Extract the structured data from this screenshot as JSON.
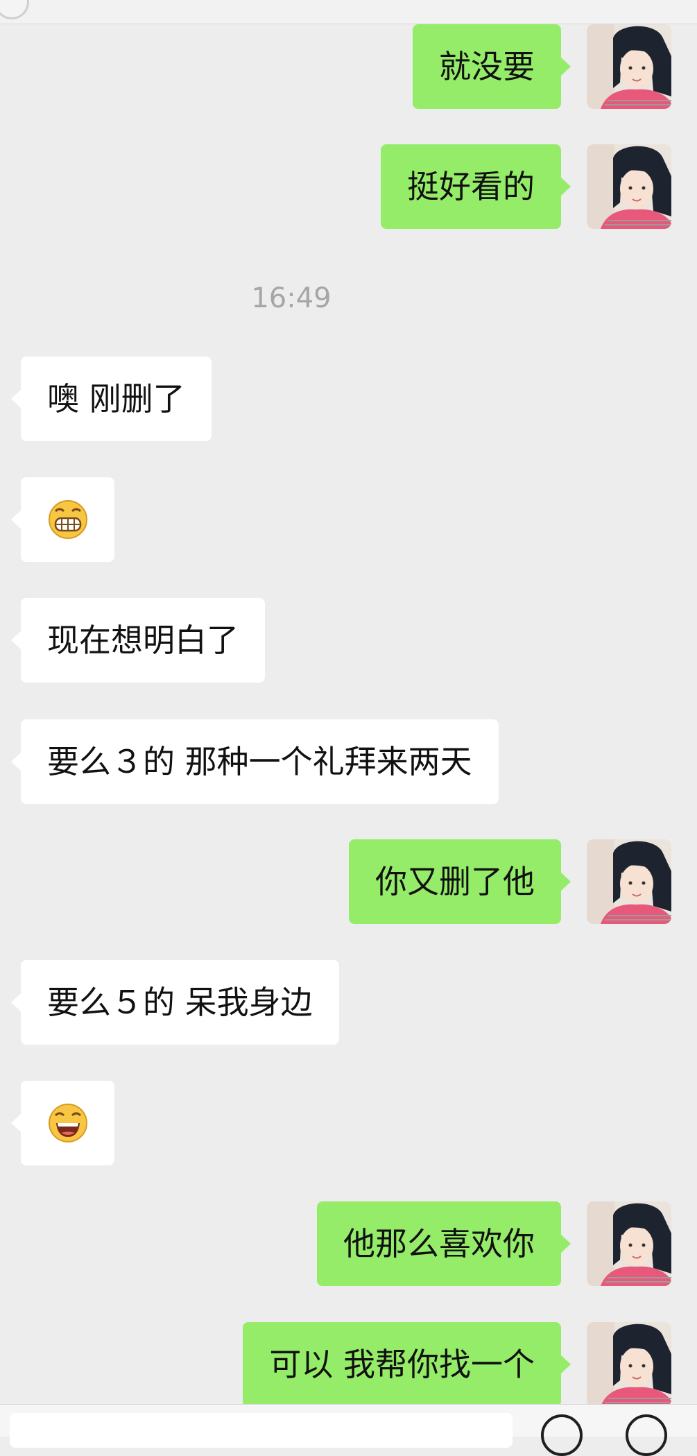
{
  "chat": {
    "timestamp": "16:49",
    "messages": [
      {
        "side": "out",
        "text": "就没要"
      },
      {
        "side": "out",
        "text": "挺好看的"
      },
      {
        "side": "in",
        "text": "噢 刚删了"
      },
      {
        "side": "in",
        "emoji": "grin-face"
      },
      {
        "side": "in",
        "text": "现在想明白了"
      },
      {
        "side": "in",
        "text": "要么３的 那种一个礼拜来两天"
      },
      {
        "side": "out",
        "text": "你又删了他"
      },
      {
        "side": "in",
        "text": "要么５的 呆我身边"
      },
      {
        "side": "in",
        "emoji": "laugh-face"
      },
      {
        "side": "out",
        "text": "他那么喜欢你"
      },
      {
        "side": "out",
        "text": "可以 我帮你找一个"
      }
    ]
  },
  "colors": {
    "background": "#ededed",
    "outgoing_bubble": "#95ec69",
    "incoming_bubble": "#ffffff",
    "timestamp_text": "#a6a6a6"
  },
  "icons": {
    "avatar": "user-avatar",
    "input_left": "voice-icon",
    "input_right": "emoji-icon"
  }
}
